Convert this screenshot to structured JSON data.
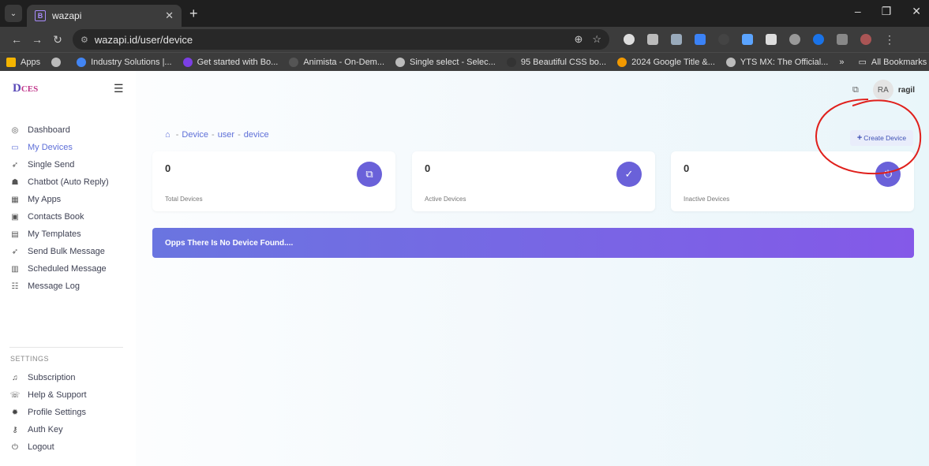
{
  "browser": {
    "tab_title": "wazapi",
    "tab_favicon": "B",
    "url": "wazapi.id/user/device",
    "bookmarks": [
      {
        "label": "Apps",
        "color": "#f4b400"
      },
      {
        "label": "",
        "color": "#bbbbbb"
      },
      {
        "label": "Industry Solutions |...",
        "color": "#4285f4"
      },
      {
        "label": "Get started with Bo...",
        "color": "#7b3fe4"
      },
      {
        "label": "Animista - On-Dem...",
        "color": "#555555"
      },
      {
        "label": "Single select - Selec...",
        "color": "#bbbbbb"
      },
      {
        "label": "95 Beautiful CSS bo...",
        "color": "#333333"
      },
      {
        "label": "2024 Google Title &...",
        "color": "#f29900"
      },
      {
        "label": "YTS MX: The Official...",
        "color": "#bbbbbb"
      }
    ],
    "more_bookmarks": "»",
    "all_bookmarks": "All Bookmarks"
  },
  "app": {
    "logo_main": "D",
    "logo_sub": "CES",
    "user_initials": "RA",
    "user_name": "ragil"
  },
  "sidebar": {
    "items": [
      {
        "label": "Dashboard",
        "icon": "dashboard-icon",
        "glyph": "◎"
      },
      {
        "label": "My Devices",
        "icon": "device-icon",
        "glyph": "▭"
      },
      {
        "label": "Single Send",
        "icon": "send-icon",
        "glyph": "➶"
      },
      {
        "label": "Chatbot (Auto Reply)",
        "icon": "robot-icon",
        "glyph": "☗"
      },
      {
        "label": "My Apps",
        "icon": "apps-icon",
        "glyph": "▦"
      },
      {
        "label": "Contacts Book",
        "icon": "contacts-icon",
        "glyph": "▣"
      },
      {
        "label": "My Templates",
        "icon": "template-icon",
        "glyph": "▤"
      },
      {
        "label": "Send Bulk Message",
        "icon": "bulk-send-icon",
        "glyph": "➶"
      },
      {
        "label": "Scheduled Message",
        "icon": "calendar-icon",
        "glyph": "▥"
      },
      {
        "label": "Message Log",
        "icon": "log-icon",
        "glyph": "☷"
      }
    ],
    "settings_title": "SETTINGS",
    "settings_items": [
      {
        "label": "Subscription",
        "icon": "subscription-icon",
        "glyph": "♫"
      },
      {
        "label": "Help & Support",
        "icon": "help-icon",
        "glyph": "☏"
      },
      {
        "label": "Profile Settings",
        "icon": "settings-icon",
        "glyph": "✹"
      },
      {
        "label": "Auth Key",
        "icon": "key-icon",
        "glyph": "⚷"
      },
      {
        "label": "Logout",
        "icon": "logout-icon",
        "glyph": "⏻"
      }
    ]
  },
  "breadcrumb": {
    "items": [
      "Device",
      "user",
      "device"
    ]
  },
  "create_button": "Create Device",
  "cards": [
    {
      "value": "0",
      "label": "Total Devices",
      "icon": "devices-icon",
      "glyph": "⧉"
    },
    {
      "value": "0",
      "label": "Active Devices",
      "icon": "check-circle-icon",
      "glyph": "✓"
    },
    {
      "value": "0",
      "label": "Inactive Devices",
      "icon": "power-icon",
      "glyph": "⏻"
    }
  ],
  "banner": "Opps There Is No Device Found....",
  "colors": {
    "accent": "#6a61d9",
    "annotation": "#e0201c"
  }
}
